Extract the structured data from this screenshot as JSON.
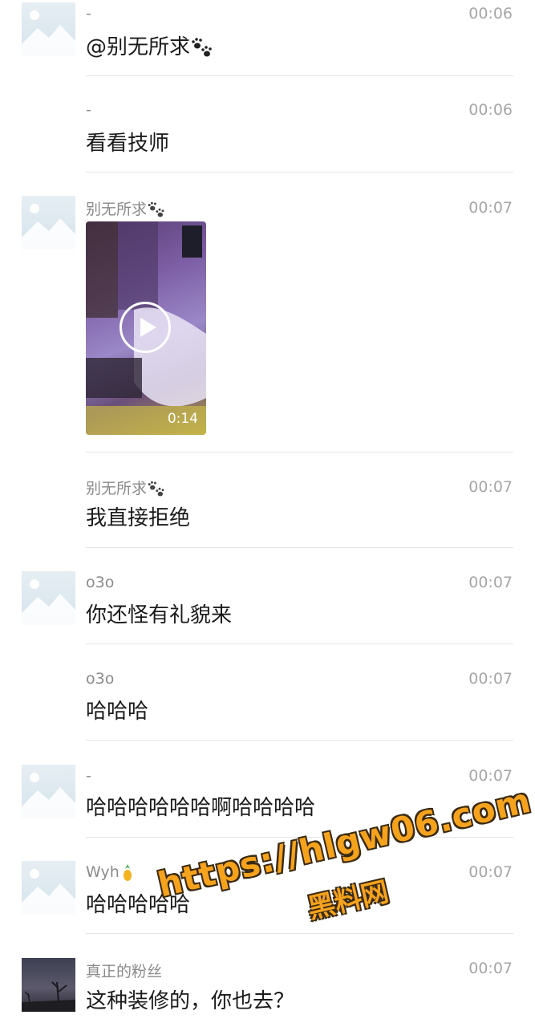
{
  "messages": [
    {
      "name": "-",
      "time": "00:06",
      "text": "@别无所求",
      "emoji": "paw-prints"
    },
    {
      "name": "-",
      "time": "00:06",
      "text": "看看技师"
    },
    {
      "name": "别无所求",
      "name_emoji": "paw-prints",
      "time": "00:07",
      "video_duration": "0:14"
    },
    {
      "name": "别无所求",
      "name_emoji": "paw-prints",
      "time": "00:07",
      "text": "我直接拒绝"
    },
    {
      "name": "o3o",
      "time": "00:07",
      "text": "你还怪有礼貌来"
    },
    {
      "name": "o3o",
      "time": "00:07",
      "text": "哈哈哈"
    },
    {
      "name": "-",
      "time": "00:07",
      "text": "哈哈哈哈哈哈啊哈哈哈哈"
    },
    {
      "name": "Wyh",
      "name_emoji": "pineapple",
      "time": "00:07",
      "text": "哈哈哈哈哈"
    },
    {
      "name": "真正的粉丝",
      "time": "00:07",
      "text": "这种装修的，你也去？"
    }
  ],
  "watermark": {
    "line1": "https://hlgw06.com",
    "line2": "黑料网"
  }
}
